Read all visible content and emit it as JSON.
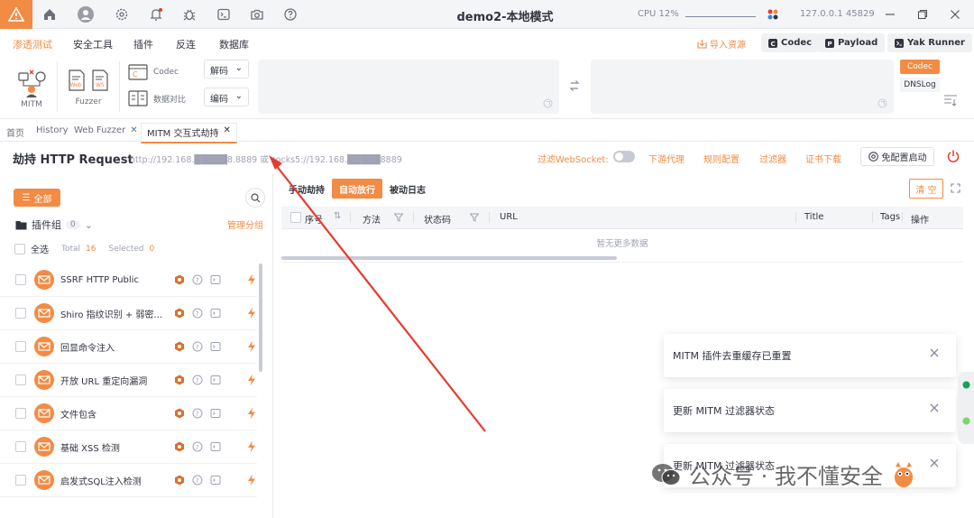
{
  "titlebar": {
    "title": "demo2-本地模式",
    "cpu_label": "CPU 12%",
    "engine_addr": "127.0.0.1 45829"
  },
  "menu": {
    "items": [
      "渗透测试",
      "安全工具",
      "插件",
      "反连",
      "数据库"
    ],
    "import_label": "导入资源",
    "codec_label": "Codec",
    "payload_label": "Payload",
    "yak_runner_label": "Yak Runner"
  },
  "ribbon": {
    "mitm_label": "MITM",
    "fuzzer_label": "Fuzzer",
    "codec_label": "Codec",
    "compare_label": "数据对比",
    "decode_label": "解码",
    "encode_label": "编码",
    "codec_tag": "Codec",
    "dnslog_tag": "DNSLog"
  },
  "tabs": [
    {
      "label": "首页"
    },
    {
      "label": "History"
    },
    {
      "label": "Web Fuzzer"
    },
    {
      "label": "MITM 交互式劫持"
    }
  ],
  "header": {
    "title": "劫持 HTTP Request",
    "proxy_url": "http://192.168.█████8.8889 或 socks5://192.168.█████8889",
    "websocket_label": "过滤WebSocket:",
    "downstream": "下游代理",
    "rules": "规则配置",
    "filter": "过滤器",
    "cert": "证书下载",
    "free_start": "免配置启动"
  },
  "leftpane": {
    "all_label": "全部",
    "group_label": "插件组",
    "group_count": "0",
    "manage_label": "管理分组",
    "select_all": "全选",
    "total_label": "Total",
    "total_value": "16",
    "selected_label": "Selected",
    "selected_value": "0",
    "plugins": [
      {
        "name": "SSRF HTTP Public"
      },
      {
        "name": "Shiro 指纹识别 + 弱密..."
      },
      {
        "name": "回显命令注入"
      },
      {
        "name": "开放 URL 重定向漏洞"
      },
      {
        "name": "文件包含"
      },
      {
        "name": "基础 XSS 检测"
      },
      {
        "name": "启发式SQL注入检测"
      }
    ]
  },
  "mainpane": {
    "mode_tabs": [
      "手动劫持",
      "自动放行",
      "被动日志"
    ],
    "active_mode": "自动放行",
    "clear_label": "清 空",
    "columns": [
      "序号",
      "方法",
      "状态码",
      "URL",
      "Title",
      "Tags",
      "操作"
    ],
    "empty_text": "暂无更多数据"
  },
  "notifications": [
    {
      "text": "MITM 插件去重缓存已重置"
    },
    {
      "text": "更新 MITM 过滤器状态"
    },
    {
      "text": "更新 MITM 过滤器状态"
    }
  ],
  "watermark": {
    "text": "公众号 · 我不懂安全"
  },
  "colors": {
    "accent": "#f28b44",
    "annotation_arrow": "#e63b2e"
  }
}
